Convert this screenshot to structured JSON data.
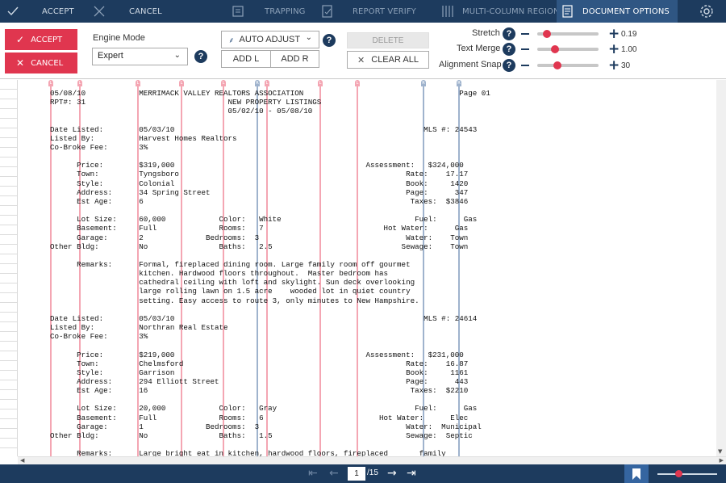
{
  "toolbar": {
    "accept_label": "ACCEPT",
    "cancel_label": "CANCEL",
    "trapping_label": "TRAPPING",
    "report_verify_label": "REPORT VERIFY",
    "multi_column_label": "MULTI-COLUMN REGION",
    "document_options_label": "DOCUMENT OPTIONS"
  },
  "options": {
    "accept_label": "ACCEPT",
    "cancel_label": "CANCEL",
    "engine_mode_label": "Engine Mode",
    "engine_mode_value": "Expert",
    "auto_adjust_label": "AUTO ADJUST",
    "add_l_label": "ADD L",
    "add_r_label": "ADD R",
    "delete_label": "DELETE",
    "clear_all_label": "CLEAR ALL",
    "stretch_label": "Stretch",
    "stretch_value": "0.19",
    "stretch_fraction": 0.1,
    "text_merge_label": "Text Merge",
    "text_merge_value": "1.00",
    "text_merge_fraction": 0.25,
    "alignment_snap_label": "Alignment Snap",
    "alignment_snap_value": "30",
    "alignment_snap_fraction": 0.3
  },
  "column_markers": [
    "L",
    "L",
    "L",
    "L",
    "L",
    "R",
    "L",
    "L",
    "L",
    "R",
    "R"
  ],
  "document": {
    "lines": [
      "05/08/10            MERRIMACK VALLEY REALTORS ASSOCIATION                                   Page 01",
      "RPT#: 31                                NEW PROPERTY LISTINGS",
      "                                        05/02/10 - 05/08/10",
      "",
      "Date Listed:        05/03/10                                                        MLS #: 24543",
      "Listed By:          Harvest Homes Realtors",
      "Co-Broke Fee:       3%",
      "",
      "      Price:        $319,000                                           Assessment:   $324,000",
      "      Town:         Tyngsboro                                                   Rate:    17.17",
      "      Style:        Colonial                                                    Book:     1420",
      "      Address:      34 Spring Street                                            Page:      347",
      "      Est Age:      6                                                            Taxes:  $3846",
      "",
      "      Lot Size:     60,000            Color:   White                              Fuel:      Gas",
      "      Basement:     Full              Rooms:   7                           Hot Water:      Gas",
      "      Garage:       2              Bedrooms:  3                                 Water:    Town",
      "Other Bldg:         No                Baths:   2.5                             Sewage:    Town",
      "",
      "      Remarks:      Formal, fireplaced dining room. Large family room off gourmet",
      "                    kitchen. Hardwood floors throughout.  Master bedroom has",
      "                    cathedral ceiling with loft and skylight. Sun deck overlooking",
      "                    large rolling lawn on 1.5 acre    wooded lot in quiet country",
      "                    setting. Easy access to route 3, only minutes to New Hampshire.",
      "",
      "Date Listed:        05/03/10                                                        MLS #: 24614",
      "Listed By:          Northran Real Estate",
      "Co-Broke Fee:       3%",
      "",
      "      Price:        $219,000                                           Assessment:   $231,000",
      "      Town:         Chelmsford                                                  Rate:    16.87",
      "      Style:        Garrison                                                    Book:     1161",
      "      Address:      294 Elliott Street                                          Page:      443",
      "      Est Age:      16                                                           Taxes:  $2210",
      "",
      "      Lot Size:     20,000            Color:   Gray                               Fuel:      Gas",
      "      Basement:     Full              Rooms:   6                          Hot Water:      Elec",
      "      Garage:       1              Bedrooms:  3                                 Water:  Municipal",
      "Other Bldg:         No                Baths:   1.5                              Sewage:  Septic",
      "",
      "      Remarks:      Large bright eat in kitchen, hardwood floors, fireplaced       family"
    ]
  },
  "pager": {
    "current_page": "1",
    "total_label": "/15"
  }
}
